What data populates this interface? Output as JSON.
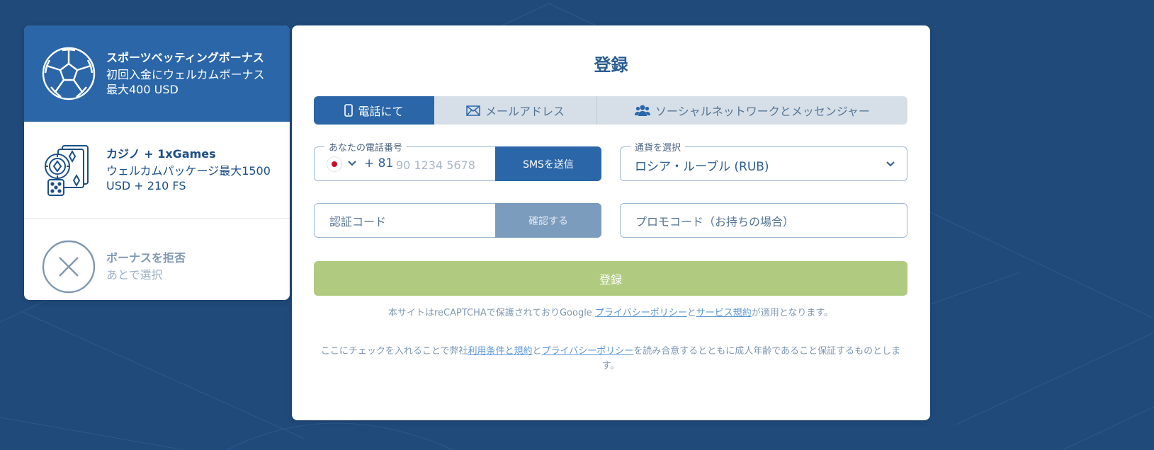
{
  "bonuses": {
    "sports": {
      "title": "スポーツベッティングボーナス",
      "desc": "初回入金にウェルカムボーナス最大400 USD"
    },
    "casino": {
      "title": "カジノ + 1xGames",
      "desc": "ウェルカムパッケージ最大1500 USD + 210 FS"
    },
    "reject": {
      "title": "ボーナスを拒否",
      "desc": "あとで選択"
    }
  },
  "registration": {
    "title": "登録",
    "tabs": {
      "phone": "電話にて",
      "email": "メールアドレス",
      "social": "ソーシャルネットワークとメッセンジャー"
    },
    "phone": {
      "legend": "あなたの電話番号",
      "dial_code": "+ 81",
      "placeholder": "90 1234 5678",
      "sms_button": "SMSを送信"
    },
    "currency": {
      "legend": "通貨を選択",
      "value": "ロシア・ルーブル (RUB)"
    },
    "verification": {
      "placeholder": "認証コード",
      "confirm_button": "確認する"
    },
    "promo": {
      "placeholder": "プロモコード（お持ちの場合）"
    },
    "submit_label": "登録",
    "recaptcha_note": {
      "prefix": "本サイトはreCAPTCHAで保護されておりGoogle ",
      "privacy": "プライバシーポリシー",
      "and": "と",
      "terms": "サービス規約",
      "suffix": "が適用となります。"
    },
    "consent_note": {
      "prefix": "ここにチェックを入れることで弊社",
      "terms": "利用条件と規約",
      "and": "と",
      "privacy": "プライバシーポリシー",
      "suffix": "を読み合意するとともに成人年齢であること保証するものとします。"
    }
  },
  "colors": {
    "background": "#1f4a7a",
    "primary": "#2a66a8",
    "submit": "#b0cb80",
    "confirm": "#7b9cbc",
    "link": "#5b97d6"
  },
  "icons": {
    "sports": "soccer-ball-icon",
    "casino": "casino-chip-cards-dice-icon",
    "reject": "close-circle-icon",
    "phone_tab": "mobile-phone-icon",
    "email_tab": "envelope-icon",
    "social_tab": "users-icon",
    "flag": "japan-flag-icon"
  }
}
